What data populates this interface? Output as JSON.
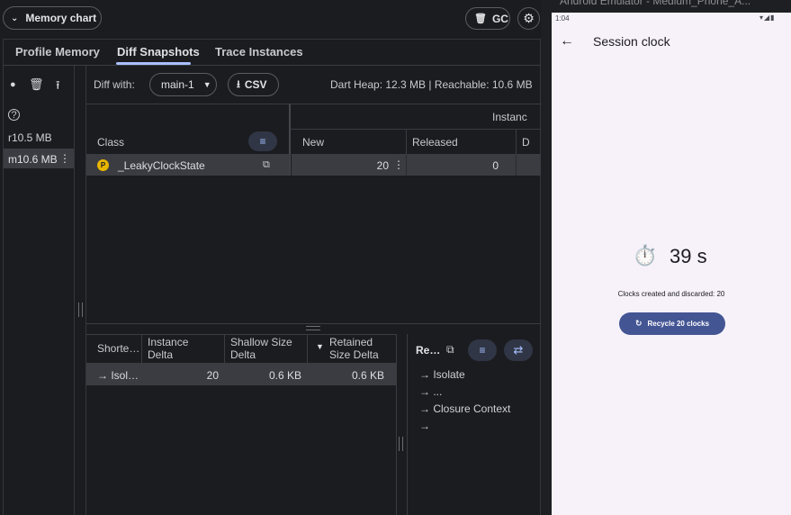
{
  "devtools": {
    "memory_chart_label": "Memory chart",
    "gc_label": "GC",
    "tabs": [
      {
        "label": "Profile Memory"
      },
      {
        "label": "Diff Snapshots"
      },
      {
        "label": "Trace Instances"
      }
    ],
    "snapshots": [
      {
        "label": "r10.5 MB"
      },
      {
        "label": "m10.6 MB"
      }
    ],
    "diff_with_label": "Diff with:",
    "diff_with_value": "main-1",
    "csv_label": "CSV",
    "heap_info": "Dart Heap: 12.3 MB | Reachable: 10.6 MB",
    "class_table": {
      "group_header": "Instanc",
      "columns": [
        "Class",
        "New",
        "Released",
        "D"
      ],
      "row": {
        "badge": "P",
        "class": "_LeakyClockState",
        "new": "20",
        "released": "0"
      }
    },
    "path_table": {
      "columns": [
        "Shorte…",
        "Instance Delta",
        "Shallow Size Delta",
        "Retained Size Delta"
      ],
      "row": {
        "path": "→ Isol…",
        "instance_delta": "20",
        "shallow": "0.6 KB",
        "retained": "0.6 KB"
      }
    },
    "retaining_path": {
      "title": "Re…",
      "lines": [
        "→ Isolate",
        "→ ...",
        "→ Closure Context",
        "→"
      ]
    }
  },
  "emulator": {
    "window_title": "Android Emulator - Medium_Phone_A...",
    "time": "1:04",
    "app_title": "Session clock",
    "stopwatch_icon": "⏱️",
    "seconds": "39 s",
    "clocks_text": "Clocks created and discarded: 20",
    "recycle_label": "Recycle 20 clocks"
  },
  "icons": {
    "settings": "gear-icon",
    "trash": "trash-icon",
    "filter": "filter-icon",
    "copy": "copy-icon",
    "swap": "swap-icon",
    "back": "back-arrow-icon",
    "refresh": "refresh-icon"
  },
  "colors": {
    "accent": "#a8c0ff",
    "button_primary": "#445594",
    "selection": "#3a3c41",
    "badge": "#e8b500"
  }
}
